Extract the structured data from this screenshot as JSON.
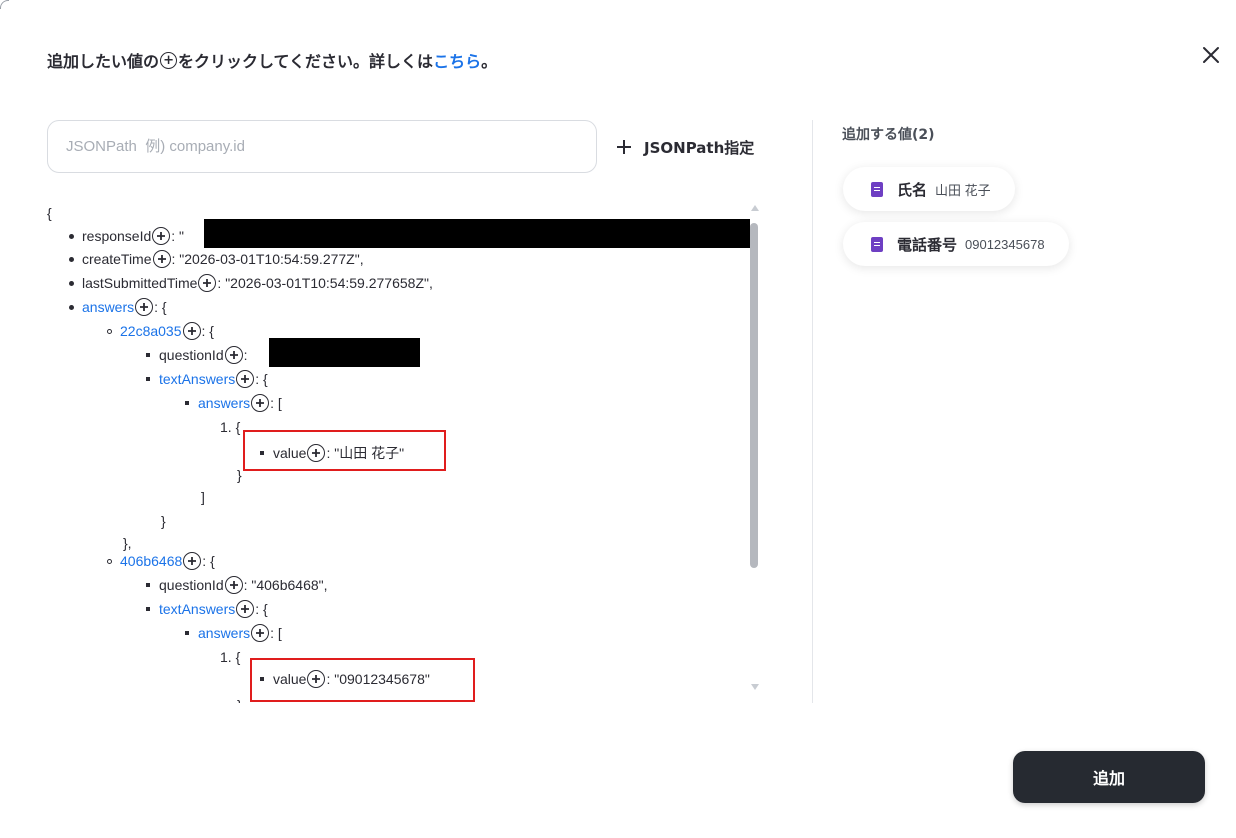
{
  "header": {
    "text_before": "追加したい値の",
    "text_after": "をクリックしてください。詳しくは",
    "link_text": "こちら",
    "text_end": "。"
  },
  "search": {
    "placeholder": "JSONPath  例) company.id",
    "value": ""
  },
  "jsonpath_button": {
    "icon": "plus-icon",
    "label": "JSONPath指定"
  },
  "tree": {
    "open_brace": "{",
    "lines": [
      {
        "key": "responseId",
        "suffix": ": \"",
        "redacted": true
      },
      {
        "key": "createTime",
        "suffix": ": \"2026-03-01T10:54:59.277Z\","
      },
      {
        "key": "lastSubmittedTime",
        "suffix": ": \"2026-03-01T10:54:59.277658Z\","
      },
      {
        "key": "answers",
        "suffix": ": {"
      },
      {
        "key": "22c8a035",
        "suffix": ": {"
      },
      {
        "key": "questionId",
        "suffix": ":",
        "redacted": true
      },
      {
        "key": "textAnswers",
        "suffix": ": {"
      },
      {
        "key": "answers",
        "suffix": ": ["
      },
      {
        "index": "1. {"
      },
      {
        "key": "value",
        "suffix": ": \"山田 花子\""
      },
      {
        "text": "}"
      },
      {
        "text": "]"
      },
      {
        "text": "}"
      },
      {
        "text": "},"
      },
      {
        "key": "406b6468",
        "suffix": ": {"
      },
      {
        "key": "questionId",
        "suffix": ": \"406b6468\","
      },
      {
        "key": "textAnswers",
        "suffix": ": {"
      },
      {
        "key": "answers",
        "suffix": ": ["
      },
      {
        "index": "1. {"
      },
      {
        "key": "value",
        "suffix": ": \"09012345678\""
      },
      {
        "text": "}"
      }
    ]
  },
  "selected": {
    "title": "追加する値(2)",
    "items": [
      {
        "label": "氏名",
        "value": "山田 花子",
        "icon": "google-forms-icon"
      },
      {
        "label": "電話番号",
        "value": "09012345678",
        "icon": "google-forms-icon"
      }
    ]
  },
  "submit_label": "追加",
  "colors": {
    "accent": "#1b73e8",
    "highlight": "#e01d1d",
    "button": "#262a31",
    "forms_purple": "#6e3fc3"
  }
}
